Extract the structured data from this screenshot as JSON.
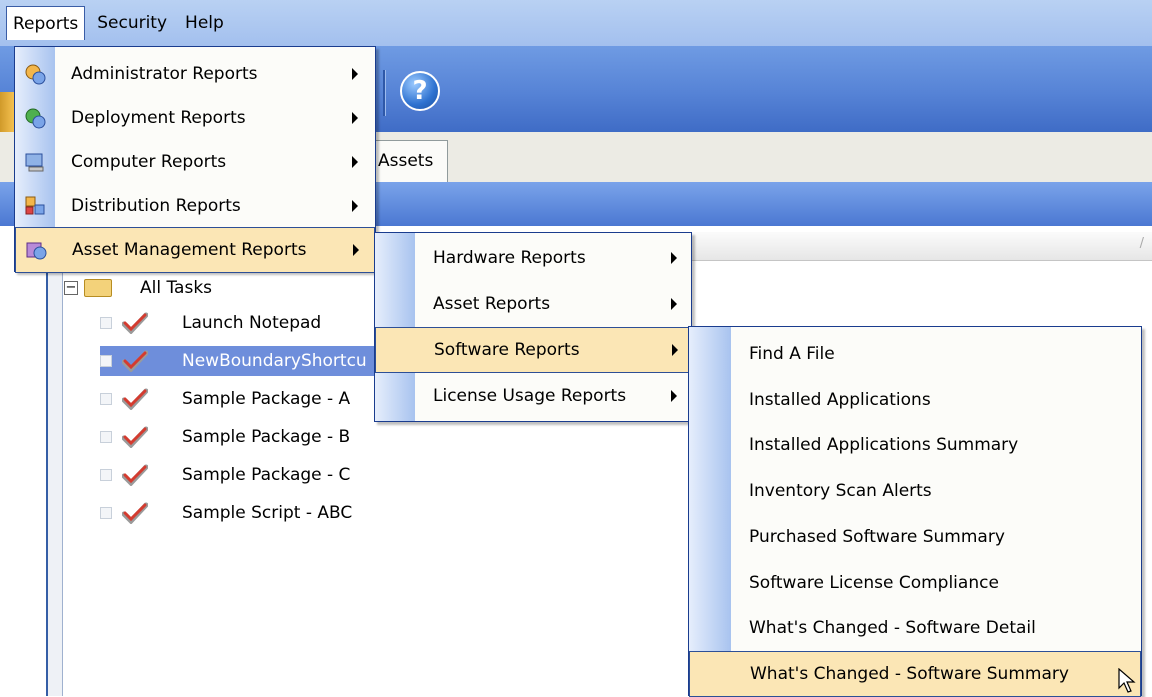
{
  "menubar": {
    "items": [
      "Reports",
      "Security",
      "Help"
    ]
  },
  "tabs": {
    "assets_label": "Assets"
  },
  "tree": {
    "root_label": "All Tasks",
    "items": [
      {
        "label": "Launch Notepad",
        "selected": false
      },
      {
        "label": "NewBoundaryShortcu",
        "selected": true
      },
      {
        "label": "Sample Package - A",
        "selected": false
      },
      {
        "label": "Sample Package - B",
        "selected": false
      },
      {
        "label": "Sample Package - C",
        "selected": false
      },
      {
        "label": "Sample Script - ABC",
        "selected": false
      }
    ]
  },
  "reports_menu": {
    "items": [
      {
        "label": "Administrator Reports",
        "icon": "admin-reports-icon"
      },
      {
        "label": "Deployment Reports",
        "icon": "deployment-reports-icon"
      },
      {
        "label": "Computer Reports",
        "icon": "computer-reports-icon"
      },
      {
        "label": "Distribution Reports",
        "icon": "distribution-reports-icon"
      },
      {
        "label": "Asset Management Reports",
        "icon": "asset-management-reports-icon",
        "highlighted": true
      }
    ]
  },
  "asset_menu": {
    "items": [
      {
        "label": "Hardware Reports"
      },
      {
        "label": "Asset Reports"
      },
      {
        "label": "Software Reports",
        "highlighted": true
      },
      {
        "label": "License Usage Reports"
      }
    ]
  },
  "software_menu": {
    "items": [
      {
        "label": "Find A File"
      },
      {
        "label": "Installed Applications"
      },
      {
        "label": "Installed Applications Summary"
      },
      {
        "label": "Inventory Scan Alerts"
      },
      {
        "label": "Purchased Software Summary"
      },
      {
        "label": "Software License Compliance"
      },
      {
        "label": "What's Changed - Software Detail"
      },
      {
        "label": "What's Changed - Software Summary",
        "highlighted": true
      }
    ]
  },
  "colors": {
    "menu_highlight": "#fbe6b5",
    "menu_border": "#1a3c8e",
    "toolbar_blue": "#5683d6",
    "tree_selection": "#6e8edb"
  }
}
